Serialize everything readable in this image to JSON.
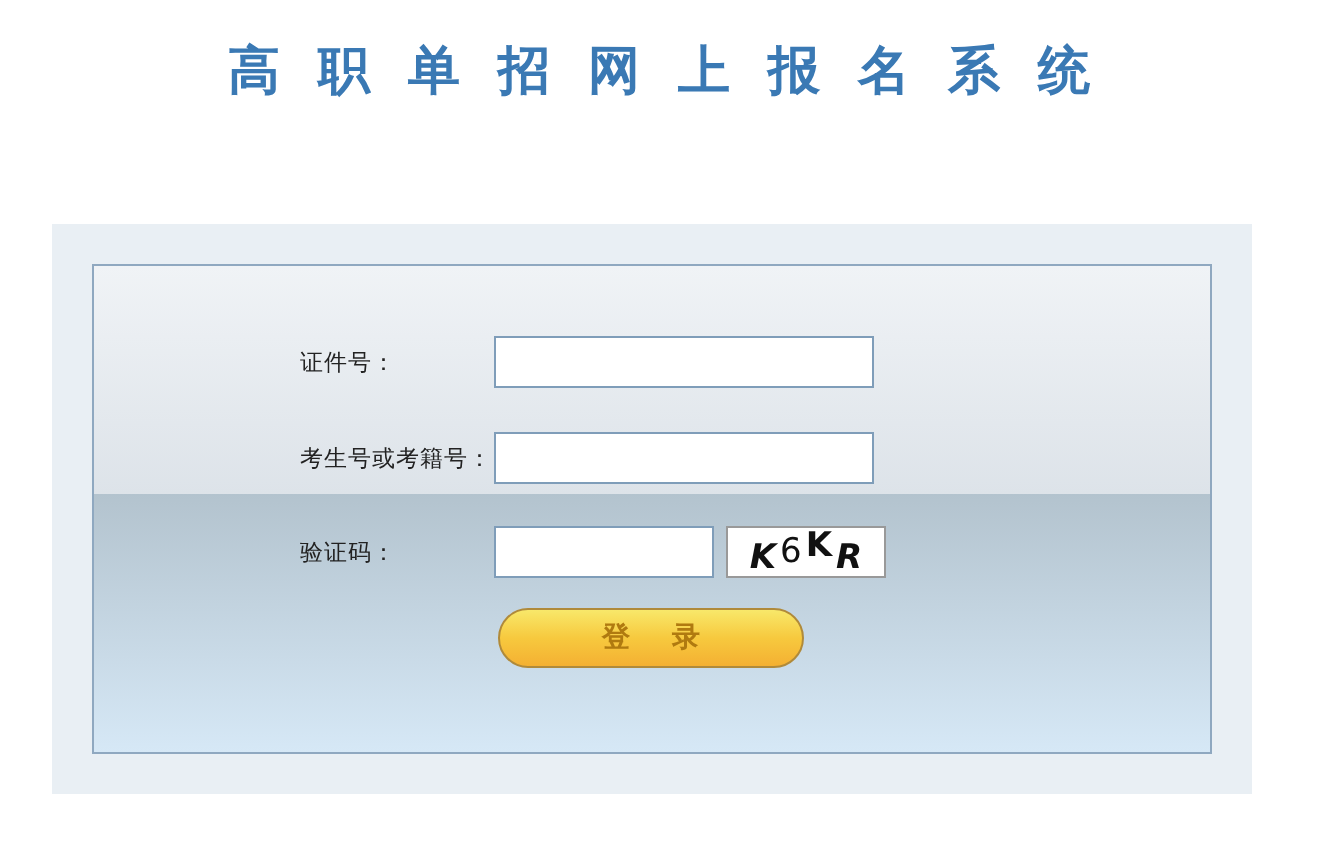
{
  "title": "高职单招网上报名系统",
  "fields": [
    {
      "label": "证件号：",
      "kind": "text"
    },
    {
      "label": "考生号或考籍号：",
      "kind": "text"
    },
    {
      "label": "验证码：",
      "kind": "captcha",
      "captcha": [
        "K",
        "6",
        "K",
        "R"
      ]
    }
  ],
  "login_button": "登 录"
}
